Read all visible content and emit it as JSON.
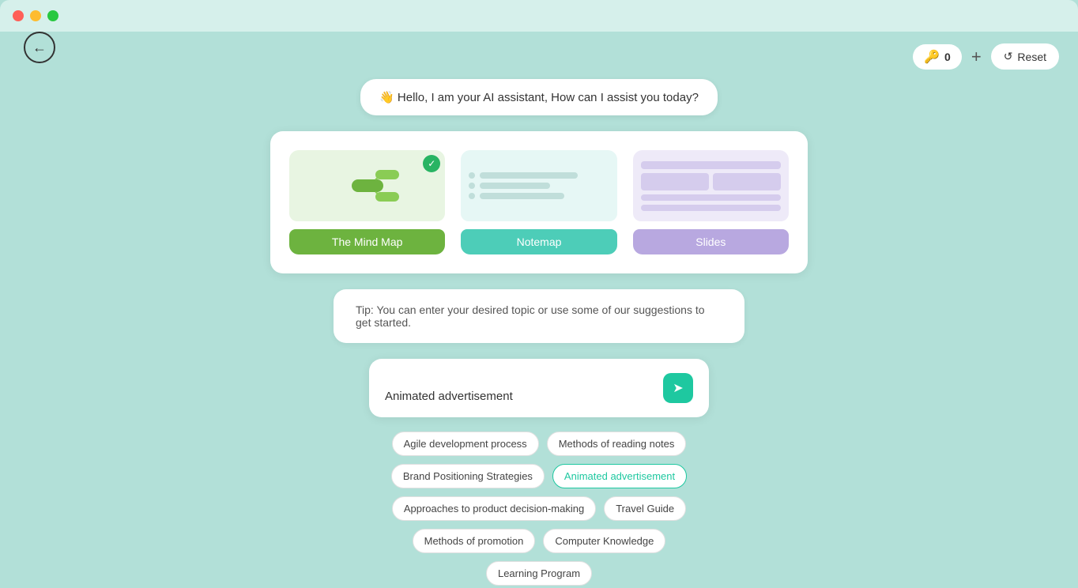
{
  "titlebar": {
    "close": "close",
    "minimize": "minimize",
    "maximize": "maximize"
  },
  "back_button": "←",
  "top_right": {
    "score": "0",
    "score_icon": "🔑",
    "add_label": "+",
    "reset_label": "Reset",
    "reset_icon": "↺"
  },
  "greeting": {
    "emoji": "👋",
    "text": "Hello, I am your AI assistant, How can I assist you today?"
  },
  "templates": [
    {
      "id": "mindmap",
      "label": "The Mind Map",
      "selected": true
    },
    {
      "id": "notemap",
      "label": "Notemap",
      "selected": false
    },
    {
      "id": "slides",
      "label": "Slides",
      "selected": false
    }
  ],
  "tip": {
    "text": "Tip: You can enter your desired topic or use some of our suggestions to get started."
  },
  "input": {
    "value": "Animated advertisement",
    "placeholder": "Animated advertisement"
  },
  "suggestions": [
    {
      "label": "Agile development process",
      "active": false
    },
    {
      "label": "Methods of reading notes",
      "active": false
    },
    {
      "label": "Brand Positioning Strategies",
      "active": false
    },
    {
      "label": "Animated advertisement",
      "active": true
    },
    {
      "label": "Approaches to product decision-making",
      "active": false
    },
    {
      "label": "Travel Guide",
      "active": false
    },
    {
      "label": "Methods of promotion",
      "active": false
    },
    {
      "label": "Computer Knowledge",
      "active": false
    },
    {
      "label": "Learning Program",
      "active": false
    }
  ]
}
